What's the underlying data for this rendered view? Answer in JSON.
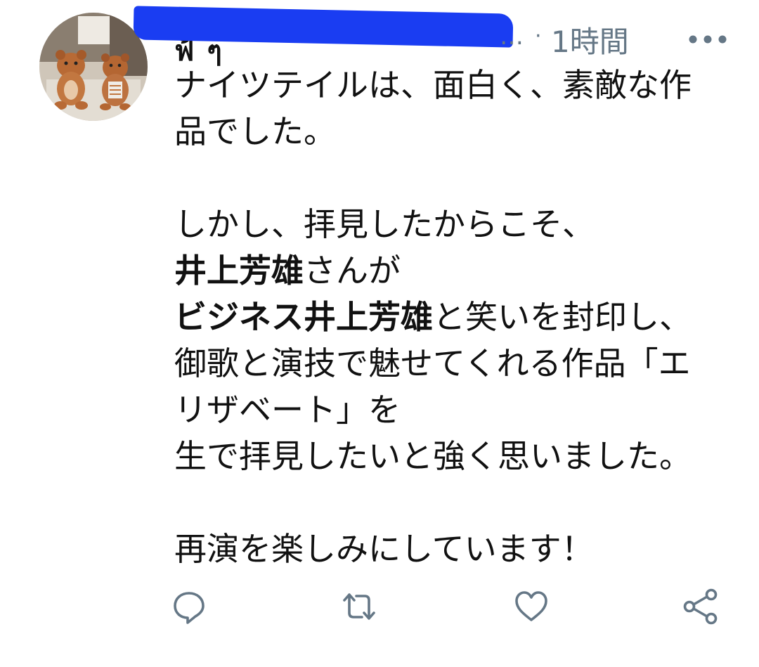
{
  "tweet": {
    "author": {
      "name_visible_fragment": "ฟ้ ๆ",
      "handle_redacted": true
    },
    "ellipsis": "…",
    "separator": "·",
    "time": "1時間",
    "body_lines": [
      {
        "segments": [
          {
            "text": "ナイツテイルは、面白く、素敵な作",
            "bold": false
          }
        ]
      },
      {
        "segments": [
          {
            "text": "品でした。",
            "bold": false
          }
        ]
      },
      {
        "blank": true
      },
      {
        "segments": [
          {
            "text": "しかし、拝見したからこそ、",
            "bold": false
          }
        ]
      },
      {
        "segments": [
          {
            "text": "井上芳雄",
            "bold": true
          },
          {
            "text": "さんが",
            "bold": false
          }
        ]
      },
      {
        "segments": [
          {
            "text": "ビジネス井上芳雄",
            "bold": true
          },
          {
            "text": "と笑いを封印し、",
            "bold": false
          }
        ]
      },
      {
        "segments": [
          {
            "text": "御歌と演技で魅せてくれる作品「エ",
            "bold": false
          }
        ]
      },
      {
        "segments": [
          {
            "text": "リザベート」を",
            "bold": false
          }
        ]
      },
      {
        "segments": [
          {
            "text": "生で拝見したいと強く思いました。",
            "bold": false
          }
        ]
      },
      {
        "blank": true
      },
      {
        "segments": [
          {
            "text": "再演を楽しみにしています！",
            "bold": false
          }
        ]
      }
    ]
  },
  "actions": [
    {
      "name": "reply-icon"
    },
    {
      "name": "retweet-icon"
    },
    {
      "name": "like-icon"
    },
    {
      "name": "share-icon"
    }
  ],
  "colors": {
    "text": "#111111",
    "secondary": "#657786",
    "redaction": "#1a3df2"
  }
}
